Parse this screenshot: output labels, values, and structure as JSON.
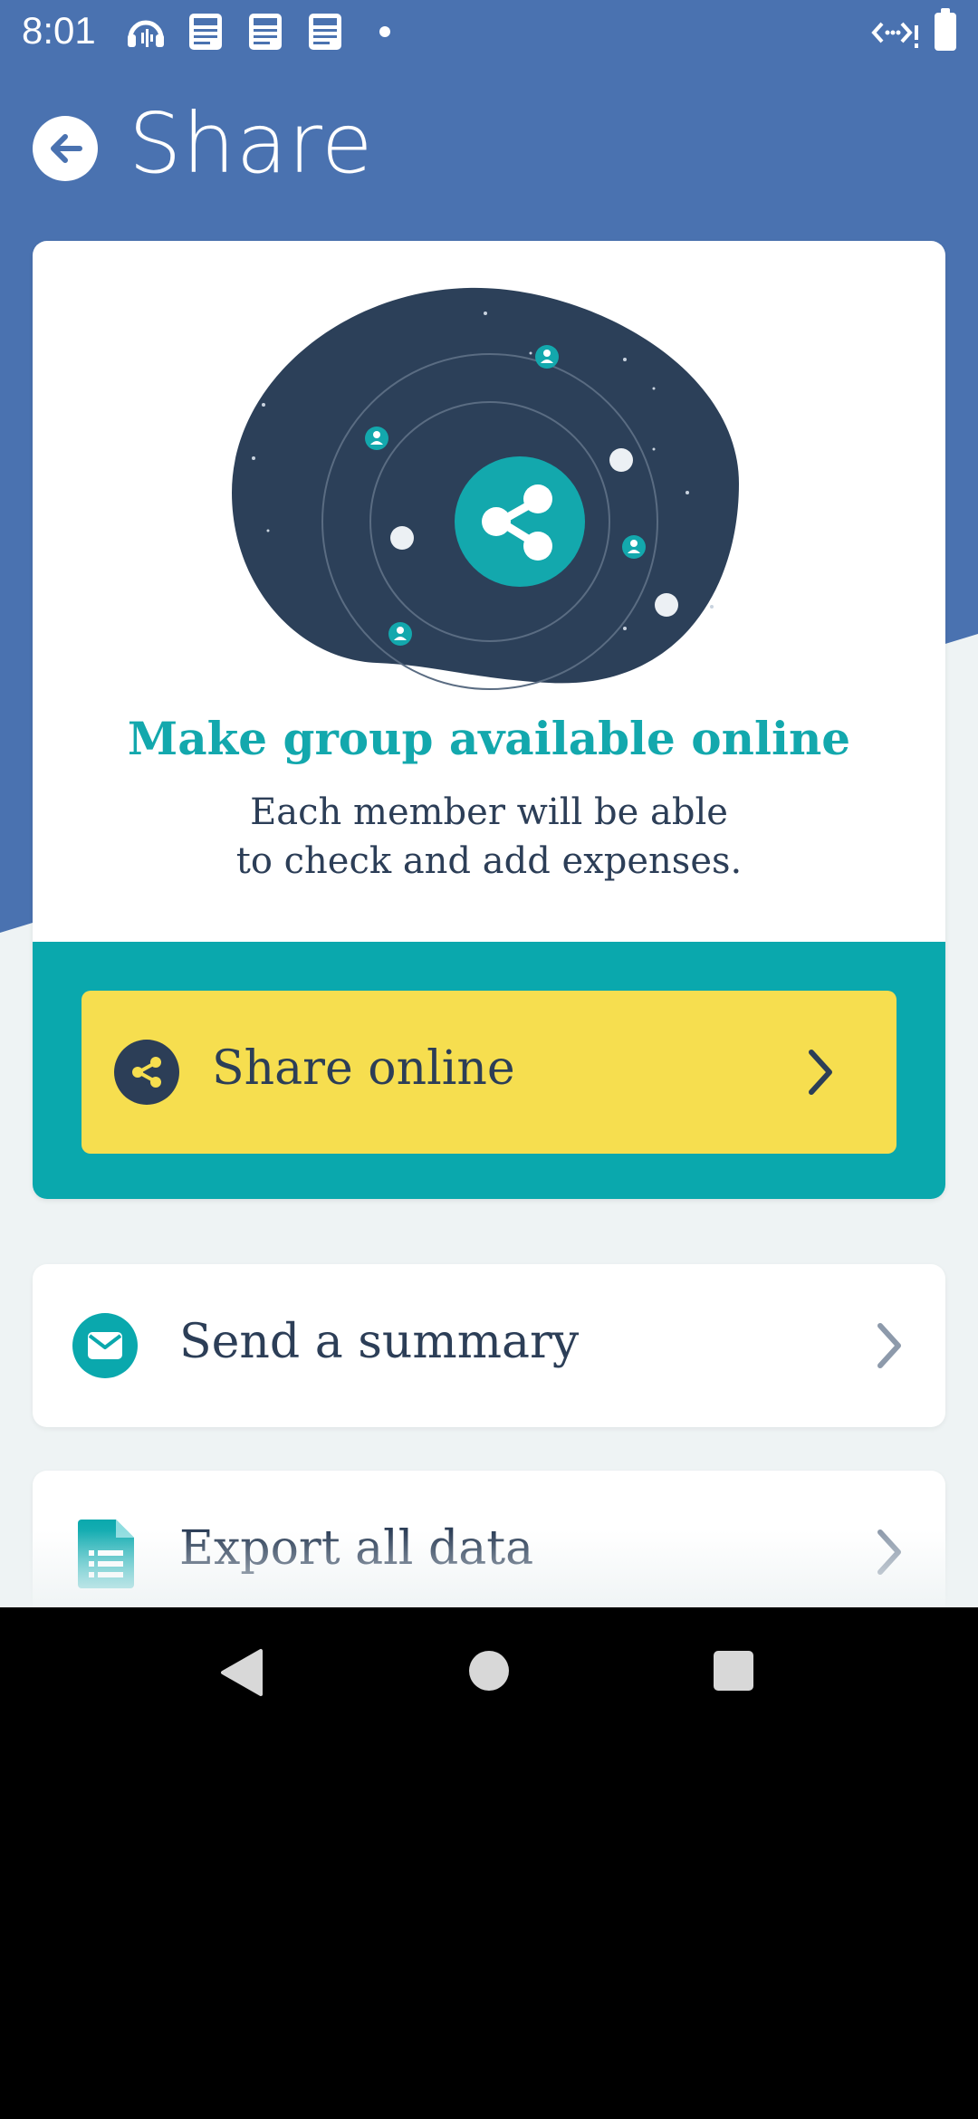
{
  "status_bar": {
    "time": "8:01"
  },
  "header": {
    "title": "Share",
    "back_label": "Back"
  },
  "main_card": {
    "heading": "Make group available online",
    "description_line1": "Each member will be able",
    "description_line2": "to check and add expenses.",
    "share_button_label": "Share online"
  },
  "list": [
    {
      "label": "Send a summary",
      "icon": "mail-icon"
    },
    {
      "label": "Export all data",
      "icon": "spreadsheet-icon"
    }
  ],
  "colors": {
    "header_blue": "#4a72b0",
    "teal": "#0aa8ad",
    "yellow": "#f6de4f",
    "navy": "#2c3e57"
  }
}
